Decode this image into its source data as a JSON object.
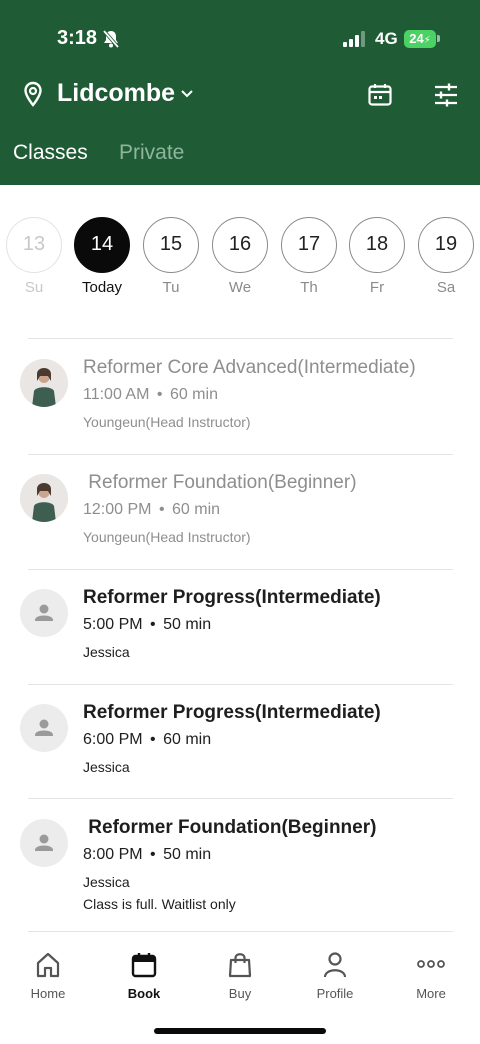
{
  "status_bar": {
    "time": "3:18",
    "network": "4G",
    "battery": "24"
  },
  "header": {
    "location": "Lidcombe"
  },
  "tabs": [
    {
      "label": "Classes",
      "active": true
    },
    {
      "label": "Private",
      "active": false
    }
  ],
  "days": [
    {
      "num": "13",
      "label": "Su",
      "state": "past"
    },
    {
      "num": "14",
      "label": "Today",
      "state": "selected"
    },
    {
      "num": "15",
      "label": "Tu",
      "state": "normal"
    },
    {
      "num": "16",
      "label": "We",
      "state": "normal"
    },
    {
      "num": "17",
      "label": "Th",
      "state": "normal"
    },
    {
      "num": "18",
      "label": "Fr",
      "state": "normal"
    },
    {
      "num": "19",
      "label": "Sa",
      "state": "normal"
    }
  ],
  "classes": [
    {
      "title": "Reformer Core Advanced(Intermediate)",
      "time": "11:00 AM",
      "duration": "60 min",
      "instructor": "Youngeun(Head Instructor)",
      "note": "",
      "past": true,
      "avatar": "photo"
    },
    {
      "title": " Reformer Foundation(Beginner)",
      "time": "12:00 PM",
      "duration": "60 min",
      "instructor": "Youngeun(Head Instructor)",
      "note": "",
      "past": true,
      "avatar": "photo"
    },
    {
      "title": "Reformer Progress(Intermediate)",
      "time": "5:00 PM",
      "duration": "50 min",
      "instructor": "Jessica",
      "note": "",
      "past": false,
      "avatar": "placeholder"
    },
    {
      "title": "Reformer Progress(Intermediate)",
      "time": "6:00 PM",
      "duration": "60 min",
      "instructor": "Jessica",
      "note": "",
      "past": false,
      "avatar": "placeholder"
    },
    {
      "title": " Reformer Foundation(Beginner)",
      "time": "8:00 PM",
      "duration": "50 min",
      "instructor": "Jessica",
      "note": "Class is full. Waitlist only",
      "past": false,
      "avatar": "placeholder"
    }
  ],
  "nav": [
    {
      "label": "Home",
      "icon": "home-icon",
      "active": false
    },
    {
      "label": "Book",
      "icon": "calendar-icon",
      "active": true
    },
    {
      "label": "Buy",
      "icon": "shopping-bag-icon",
      "active": false
    },
    {
      "label": "Profile",
      "icon": "person-icon",
      "active": false
    },
    {
      "label": "More",
      "icon": "more-dots-icon",
      "active": false
    }
  ],
  "colors": {
    "brand": "#1f5c35",
    "tab_inactive": "#8fb69c",
    "selected_day": "#0a0a0a",
    "battery": "#4cd264"
  }
}
